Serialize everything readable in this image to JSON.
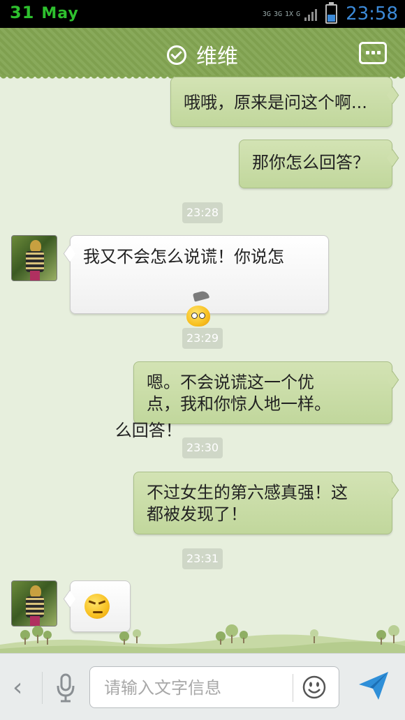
{
  "status_bar": {
    "day": "31",
    "month": "May",
    "network_labels": [
      "3G",
      "3G",
      "1X",
      "G"
    ],
    "time": "23:58"
  },
  "header": {
    "title": "维维",
    "icons": {
      "verified": "check-circle-icon",
      "menu": "more-menu-icon"
    }
  },
  "messages": [
    {
      "side": "out",
      "text": "哦哦，原来是问这个啊..."
    },
    {
      "side": "out",
      "text": "那你怎么回答？"
    },
    {
      "type": "timestamp",
      "text": "23:28"
    },
    {
      "side": "in",
      "text_line1": "我又不会怎么说谎！你说怎",
      "text_line2": "么回答！",
      "emoji": "hat-peek-emoji"
    },
    {
      "type": "timestamp",
      "text": "23:29"
    },
    {
      "side": "out",
      "text": "嗯。不会说谎这一个优\n点，我和你惊人地一样。"
    },
    {
      "type": "timestamp",
      "text": "23:30"
    },
    {
      "side": "out",
      "text": "不过女生的第六感真强！这\n都被发现了！"
    },
    {
      "type": "timestamp",
      "text": "23:31"
    },
    {
      "side": "in",
      "emoji": "annoyed-emoji"
    }
  ],
  "input_bar": {
    "placeholder": "请输入文字信息",
    "icons": [
      "back-chevron-icon",
      "microphone-icon",
      "smiley-icon",
      "send-icon"
    ]
  },
  "colors": {
    "header": "#83a552",
    "chat_background": "#e7efdd",
    "outgoing_bubble": "#c9dca6",
    "incoming_bubble": "#ffffff",
    "time_color": "#3c8ad8"
  }
}
